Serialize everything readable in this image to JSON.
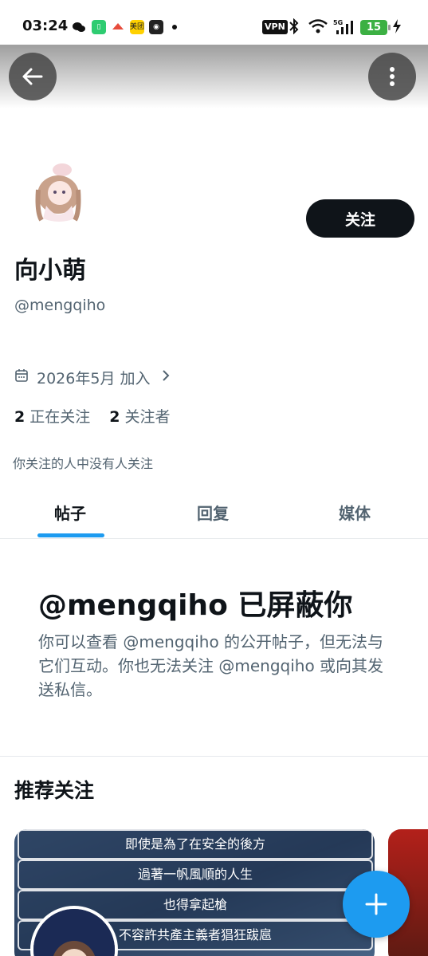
{
  "status_bar": {
    "time": "03:24",
    "vpn": "VPN",
    "network": "5G",
    "battery": "15",
    "meituan": "美团"
  },
  "profile": {
    "display_name": "向小萌",
    "handle": "@mengqiho",
    "joined": "2026年5月 加入",
    "following_count": "2",
    "following_label": "正在关注",
    "followers_count": "2",
    "followers_label": "关注者",
    "follow_button": "关注",
    "followed_by_notice": "你关注的人中没有人关注"
  },
  "tabs": [
    {
      "label": "帖子",
      "active": true
    },
    {
      "label": "回复",
      "active": false
    },
    {
      "label": "媒体",
      "active": false
    }
  ],
  "blocked": {
    "title": "@mengqiho 已屏蔽你",
    "body": "你可以查看 @mengqiho 的公开帖子，但无法与它们互动。你也无法关注 @mengqiho 或向其发送私信。"
  },
  "recommendations": {
    "title": "推荐关注",
    "card_lines": [
      "即使是為了在安全的後方",
      "過著一帆風順的人生",
      "也得拿起槍",
      "不容許共產主義者猖狂跋扈"
    ]
  },
  "colors": {
    "accent": "#1d9bf0",
    "text_primary": "#0f1419",
    "text_secondary": "#536471"
  },
  "icons": {
    "back": "arrow-left-icon",
    "more": "vertical-dots-icon",
    "calendar": "calendar-icon",
    "compose": "plus-icon"
  }
}
